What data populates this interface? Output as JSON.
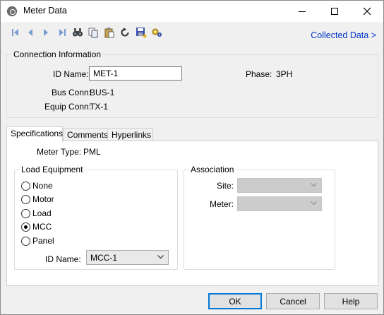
{
  "window": {
    "title": "Meter Data"
  },
  "toolbar": {
    "icons": [
      "first-icon",
      "previous-icon",
      "next-icon",
      "last-icon",
      "binoculars-find-icon",
      "copy-icon",
      "paste-icon",
      "undo-icon",
      "save-icon",
      "settings-icon"
    ],
    "collected_link": "Collected Data >"
  },
  "connection": {
    "legend": "Connection Information",
    "id_name_label": "ID Name:",
    "id_name_value": "MET-1",
    "phase_label": "Phase:",
    "phase_value": "3PH",
    "bus_conn_label": "Bus Conn:",
    "bus_conn_value": "BUS-1",
    "equip_conn_label": "Equip Conn:",
    "equip_conn_value": "TX-1"
  },
  "tabs": [
    {
      "label": "Specifications",
      "active": true
    },
    {
      "label": "Comments",
      "active": false
    },
    {
      "label": "Hyperlinks",
      "active": false
    }
  ],
  "specs": {
    "meter_type_label": "Meter Type:",
    "meter_type_value": "PML",
    "load_equipment": {
      "legend": "Load Equipment",
      "options": [
        {
          "label": "None",
          "checked": false
        },
        {
          "label": "Motor",
          "checked": false
        },
        {
          "label": "Load",
          "checked": false
        },
        {
          "label": "MCC",
          "checked": true
        },
        {
          "label": "Panel",
          "checked": false
        }
      ],
      "id_name_label": "ID Name:",
      "id_name_value": "MCC-1"
    },
    "association": {
      "legend": "Association",
      "site_label": "Site:",
      "site_value": "",
      "meter_label": "Meter:",
      "meter_value": ""
    }
  },
  "buttons": {
    "ok": "OK",
    "cancel": "Cancel",
    "help": "Help"
  }
}
